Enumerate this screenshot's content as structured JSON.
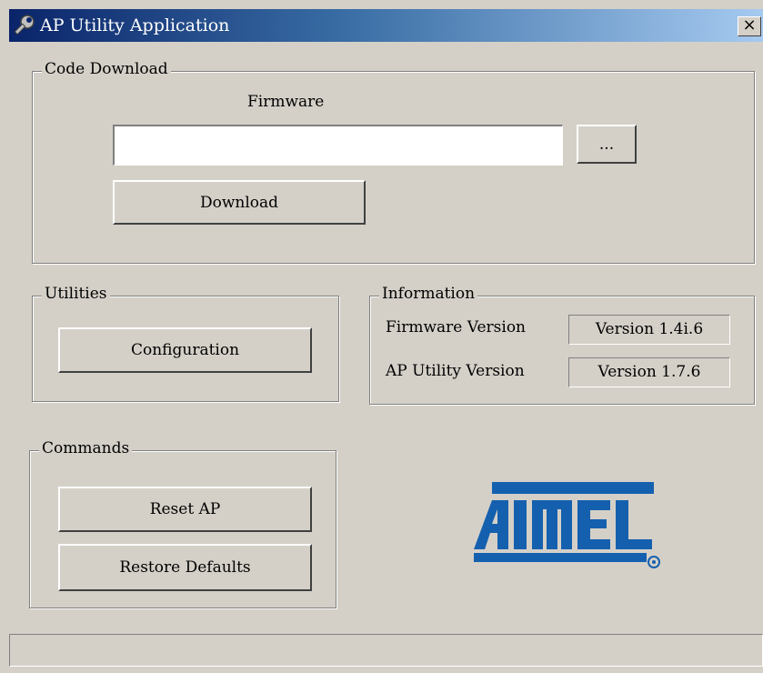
{
  "window": {
    "title": "AP Utility Application",
    "close_label": "×"
  },
  "code_download": {
    "group_label": "Code Download",
    "firmware_label": "Firmware",
    "firmware_path_value": "",
    "browse_label": "...",
    "download_label": "Download"
  },
  "utilities": {
    "group_label": "Utilities",
    "configuration_label": "Configuration"
  },
  "information": {
    "group_label": "Information",
    "firmware_version_label": "Firmware Version",
    "firmware_version_value": "Version 1.4i.6",
    "utility_version_label": "AP Utility Version",
    "utility_version_value": "Version 1.7.6"
  },
  "commands": {
    "group_label": "Commands",
    "reset_label": "Reset AP",
    "restore_label": "Restore Defaults"
  },
  "logo": {
    "text": "ATMEL",
    "color": "#1560ae"
  },
  "status_bar": {
    "text": ""
  }
}
